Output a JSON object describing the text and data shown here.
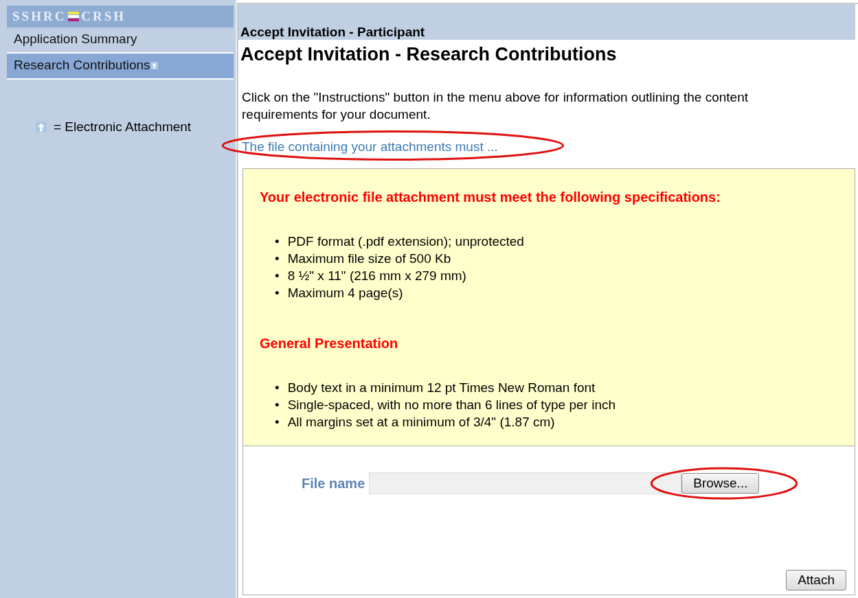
{
  "sidebar": {
    "logo": {
      "left": "SSHRC",
      "right": "CRSH"
    },
    "items": [
      {
        "label": "Application Summary",
        "selected": false,
        "attachment": false
      },
      {
        "label": "Research Contributions",
        "selected": true,
        "attachment": true
      }
    ],
    "legend": "= Electronic Attachment"
  },
  "header": {
    "subtitle": "Accept Invitation - Participant",
    "title": "Accept Invitation - Research Contributions"
  },
  "intro": "Click on the \"Instructions\" button in the menu above for information outlining the content requirements for your document.",
  "link": {
    "label": "The file containing your attachments must ...",
    "highlighted": true
  },
  "specs": {
    "marker": "•",
    "sections": [
      {
        "heading": "Your electronic file attachment must meet the following specifications:",
        "bullets": [
          "PDF format (.pdf extension); unprotected",
          "Maximum file size of 500 Kb",
          "8 ½\" x 11\" (216 mm x 279 mm)",
          "Maximum 4 page(s)"
        ]
      },
      {
        "heading": "General Presentation",
        "bullets": [
          "Body text in a minimum 12 pt Times New Roman font",
          "Single-spaced, with no more than 6 lines of type per inch",
          "All margins set at a minimum of 3/4\" (1.87 cm)"
        ]
      }
    ]
  },
  "upload": {
    "label": "File name",
    "browse": {
      "label": "Browse...",
      "highlighted": true
    },
    "attach": "Attach"
  }
}
